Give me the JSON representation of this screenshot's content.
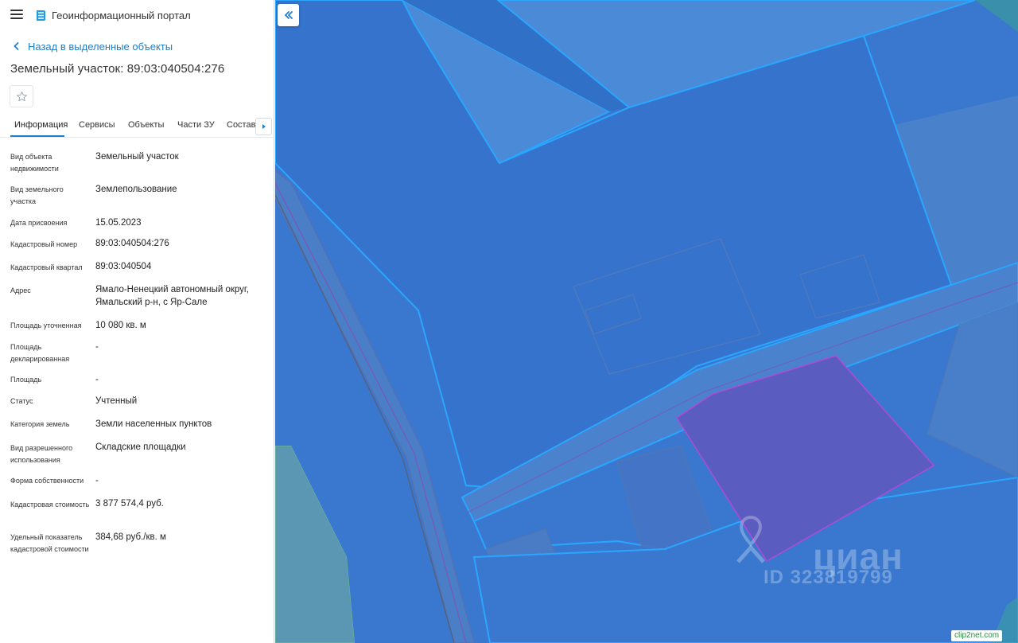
{
  "header": {
    "app_title": "Геоинформационный портал"
  },
  "nav": {
    "back_label": "Назад в выделенные объекты"
  },
  "object": {
    "title": "Земельный участок: 89:03:040504:276"
  },
  "tabs": [
    {
      "label": "Информация",
      "active": true
    },
    {
      "label": "Сервисы",
      "active": false
    },
    {
      "label": "Объекты",
      "active": false
    },
    {
      "label": "Части ЗУ",
      "active": false
    },
    {
      "label": "Состав",
      "active": false
    }
  ],
  "properties": [
    {
      "label": "Вид объекта недвижимости",
      "value": "Земельный участок"
    },
    {
      "label": "Вид земельного участка",
      "value": "Землепользование"
    },
    {
      "label": "Дата присвоения",
      "value": "15.05.2023"
    },
    {
      "label": "Кадастровый номер",
      "value": "89:03:040504:276"
    },
    {
      "label": "Кадастровый квартал",
      "value": "89:03:040504"
    },
    {
      "label": "Адрес",
      "value": "Ямало-Ненецкий автономный округ, Ямальский р-н, с Яр-Сале"
    },
    {
      "label": "Площадь уточненная",
      "value": "10 080 кв. м"
    },
    {
      "label": "Площадь декларированная",
      "value": "-"
    },
    {
      "label": "Площадь",
      "value": "-"
    },
    {
      "label": "Статус",
      "value": "Учтенный"
    },
    {
      "label": "Категория земель",
      "value": "Земли населенных пунктов"
    },
    {
      "label": "Вид разрешенного использования",
      "value": "Складские площадки"
    },
    {
      "label": "Форма собственности",
      "value": "-"
    },
    {
      "label": "Кадастровая стоимость",
      "value": "3 877 574,4 руб."
    },
    {
      "label": "Удельный показатель кадастровой стоимости",
      "value": "384,68 руб./кв. м"
    }
  ],
  "map": {
    "watermark_brand": "циан",
    "watermark_id": "ID 323819799",
    "credit": "clip2net.com"
  },
  "icons": {
    "menu": "hamburger-icon",
    "logo": "portal-logo-icon",
    "back": "chevron-left-icon",
    "favorite": "star-outline-icon",
    "tabs_more": "triangle-right-icon",
    "collapse": "double-chevron-left-icon"
  },
  "colors": {
    "accent": "#1f7ec8",
    "map_base": "#3a78cf",
    "parcel_highlight": "#5a5cc0",
    "parcel_outline": "#2aa6ff"
  }
}
